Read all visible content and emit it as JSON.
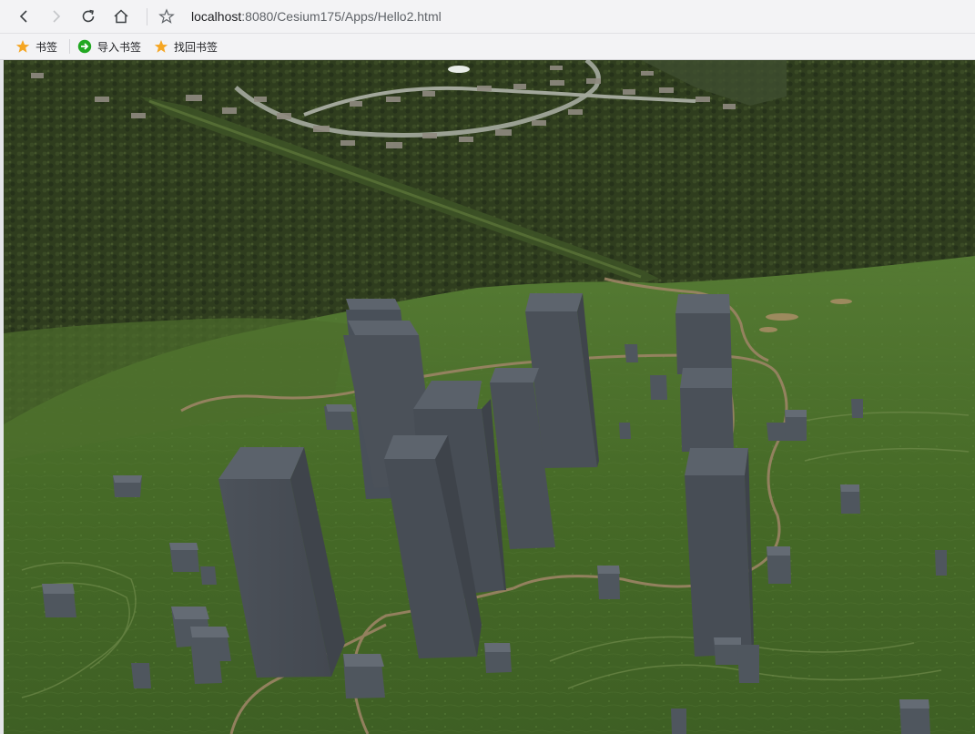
{
  "browser": {
    "address_host": "localhost",
    "address_path": ":8080/Cesium175/Apps/Hello2.html",
    "bookmarks": [
      {
        "label": "书签",
        "icon": "star-icon"
      },
      {
        "label": "导入书签",
        "icon": "import-arrow-icon"
      },
      {
        "label": "找回书签",
        "icon": "star-icon"
      }
    ],
    "icons": [
      "back-icon",
      "forward-icon",
      "reload-icon",
      "home-icon",
      "bookmark-star-icon"
    ]
  },
  "scene": {
    "description_colors": {
      "forest": "#2c3a1c",
      "meadow": "#4a6a2a",
      "building": "#4a5058",
      "building_top": "#5b626b",
      "trail": "#9a8060"
    }
  }
}
